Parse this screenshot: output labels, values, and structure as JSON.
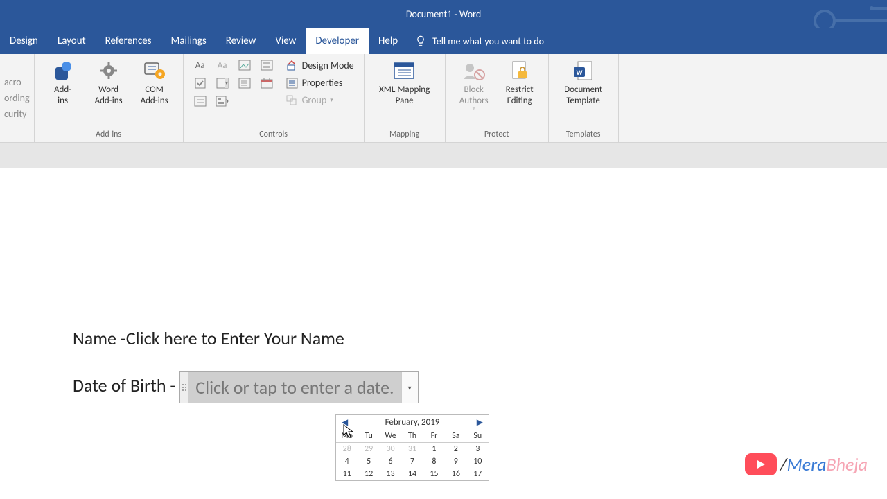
{
  "title": "Document1  -  Word",
  "tabs": [
    "Design",
    "Layout",
    "References",
    "Mailings",
    "Review",
    "View",
    "Developer",
    "Help"
  ],
  "active_tab_index": 6,
  "tell_me": "Tell me what you want to do",
  "left_fragments": [
    "acro",
    "ording",
    "curity"
  ],
  "groups": {
    "addins": {
      "label": "Add-ins",
      "items": [
        "Add-\nins",
        "Word\nAdd-ins",
        "COM\nAdd-ins"
      ]
    },
    "controls": {
      "label": "Controls",
      "design_mode": "Design Mode",
      "properties": "Properties",
      "group": "Group"
    },
    "mapping": {
      "label": "Mapping",
      "btn": "XML Mapping\nPane"
    },
    "protect": {
      "label": "Protect",
      "block": "Block\nAuthors",
      "restrict": "Restrict\nEditing"
    },
    "templates": {
      "label": "Templates",
      "btn": "Document\nTemplate"
    }
  },
  "doc": {
    "name_line": "Name -Click here to Enter Your Name",
    "dob_label": "Date of Birth -",
    "dob_placeholder": "Click or tap to enter a date."
  },
  "calendar": {
    "title": "February, 2019",
    "dow": [
      "Mo",
      "Tu",
      "We",
      "Th",
      "Fr",
      "Sa",
      "Su"
    ],
    "rows": [
      [
        {
          "d": "28",
          "f": 1
        },
        {
          "d": "29",
          "f": 1
        },
        {
          "d": "30",
          "f": 1
        },
        {
          "d": "31",
          "f": 1
        },
        {
          "d": "1"
        },
        {
          "d": "2"
        },
        {
          "d": "3"
        }
      ],
      [
        {
          "d": "4"
        },
        {
          "d": "5"
        },
        {
          "d": "6"
        },
        {
          "d": "7"
        },
        {
          "d": "8"
        },
        {
          "d": "9"
        },
        {
          "d": "10"
        }
      ],
      [
        {
          "d": "11"
        },
        {
          "d": "12"
        },
        {
          "d": "13"
        },
        {
          "d": "14"
        },
        {
          "d": "15"
        },
        {
          "d": "16"
        },
        {
          "d": "17"
        }
      ]
    ]
  },
  "watermark": {
    "slash": " / ",
    "brand_a": "Mera",
    "brand_b": " Bheja"
  }
}
